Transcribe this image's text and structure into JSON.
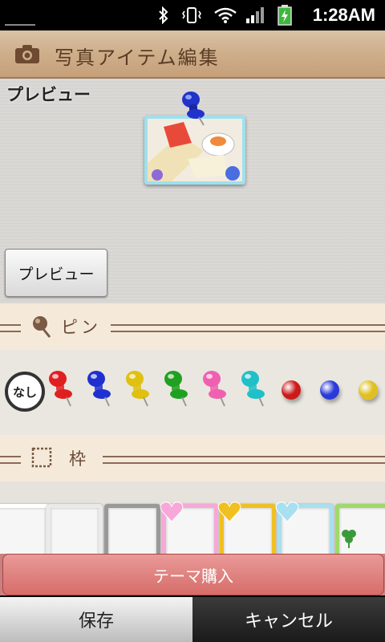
{
  "status_bar": {
    "time": "1:28AM",
    "icons": [
      "bluetooth-icon",
      "vibrate-icon",
      "wifi-icon",
      "signal-icon",
      "battery-charging-icon"
    ]
  },
  "title_bar": {
    "icon": "camera-icon",
    "title": "写真アイテム編集"
  },
  "preview": {
    "label": "プレビュー",
    "button_label": "プレビュー"
  },
  "pin_section": {
    "icon": "pin-icon",
    "label": "ピン",
    "none_label": "なし",
    "pins": [
      {
        "name": "red",
        "color": "#e02020"
      },
      {
        "name": "blue",
        "color": "#2030d0"
      },
      {
        "name": "yellow",
        "color": "#e0c010"
      },
      {
        "name": "green",
        "color": "#20a020"
      },
      {
        "name": "pink",
        "color": "#f060b0"
      },
      {
        "name": "cyan",
        "color": "#20c0c8"
      }
    ],
    "balls": [
      {
        "name": "red",
        "color": "#cc1a1a"
      },
      {
        "name": "blue",
        "color": "#2a3ad8"
      },
      {
        "name": "yellow",
        "color": "#e0c020"
      }
    ]
  },
  "frame_section": {
    "icon": "frame-icon",
    "label": "枠",
    "frames": [
      {
        "name": "white",
        "border": "#ffffff"
      },
      {
        "name": "light-gray",
        "border": "#eaeaea"
      },
      {
        "name": "gray",
        "border": "#999999"
      },
      {
        "name": "pink-heart",
        "border": "#f7a8d8"
      },
      {
        "name": "orange-heart",
        "border": "#f0c020"
      },
      {
        "name": "blue-heart",
        "border": "#a8e0f0"
      },
      {
        "name": "green-clover",
        "border": "#9fd96a"
      }
    ]
  },
  "theme_button": "テーマ購入",
  "bottom": {
    "save": "保存",
    "cancel": "キャンセル"
  },
  "colors": {
    "accent": "#d66d6a",
    "title_text": "#5a3c24"
  }
}
